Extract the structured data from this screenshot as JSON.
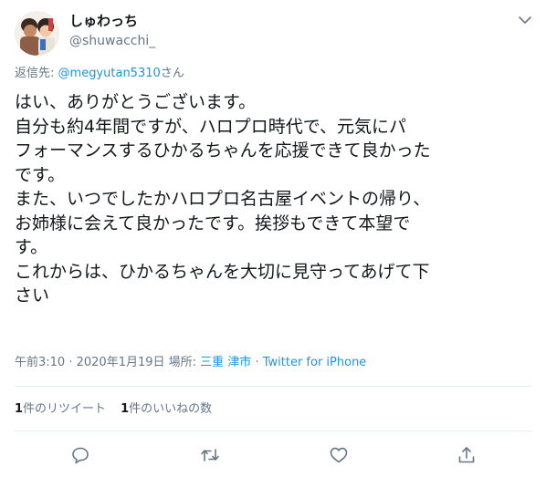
{
  "author": {
    "display_name": "しゅわっち",
    "handle": "@shuwacchi_"
  },
  "reply_to": {
    "prefix": "返信先:",
    "mention": "@megyutan5310",
    "suffix": "さん"
  },
  "tweet_lines": [
    "はい、ありがとうございます。",
    "自分も約4年間ですが、ハロプロ時代で、元気にパ",
    "フォーマンスするひかるちゃんを応援できて良かった",
    "です。",
    "また、いつでしたかハロプロ名古屋イベントの帰り、",
    "お姉様に会えて良かったです。挨拶もできて本望で",
    "す。",
    "これからは、ひかるちゃんを大切に見守ってあげて下",
    "さい"
  ],
  "meta": {
    "time": "午前3:10",
    "sep1": " · ",
    "date": "2020年1月19日",
    "location_prefix": " 場所: ",
    "location": "三重 津市",
    "sep2": " · ",
    "source": "Twitter for iPhone"
  },
  "stats": {
    "retweets_count": "1",
    "retweets_label": "件のリツイート",
    "likes_count": "1",
    "likes_label": "件のいいねの数"
  },
  "icons": {
    "caret": "chevron-down-icon",
    "reply": "reply-icon",
    "retweet": "retweet-icon",
    "like": "heart-icon",
    "share": "share-icon"
  },
  "colors": {
    "link": "#1b95e0",
    "secondary": "#657786",
    "text": "#14171a",
    "divider": "#e6ecf0"
  }
}
